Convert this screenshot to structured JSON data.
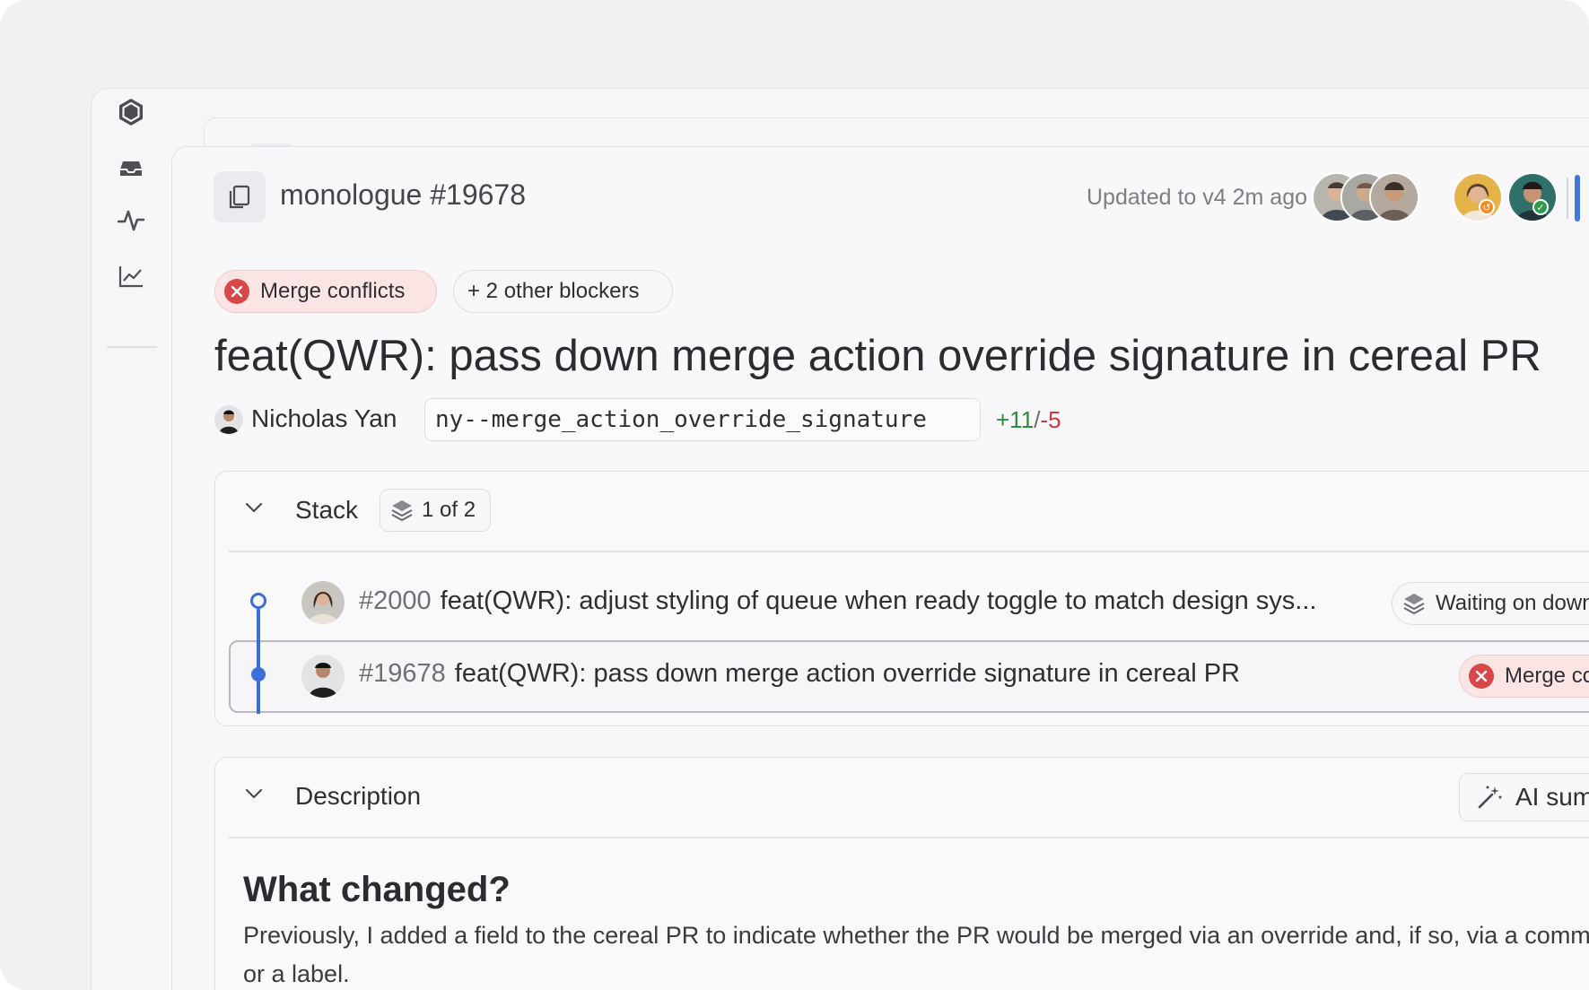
{
  "header": {
    "repo_title": "monologue #19678",
    "updated_text": "Updated to v4 2m ago",
    "reviewers": [
      "reviewer-1",
      "reviewer-2",
      "reviewer-3",
      "reviewer-4",
      "reviewer-5"
    ]
  },
  "blockers": {
    "merge_conflicts_label": "Merge conflicts",
    "other_blockers_label": "+ 2 other blockers"
  },
  "pr": {
    "title": "feat(QWR): pass down merge action override signature in cereal PR",
    "author": "Nicholas Yan",
    "branch": "ny--merge_action_override_signature",
    "additions": "+11",
    "separator": "/",
    "deletions": "-5"
  },
  "stack": {
    "title": "Stack",
    "count_label": "1 of 2",
    "items": [
      {
        "number": "#2000",
        "title": "feat(QWR): adjust styling of queue when ready toggle to match design sys...",
        "status": "Waiting on downstack"
      },
      {
        "number": "#19678",
        "title": "feat(QWR): pass down merge action override signature in cereal PR",
        "status": "Merge conflicts"
      }
    ]
  },
  "description": {
    "title": "Description",
    "ai_button_label": "AI summary",
    "heading": "What changed?",
    "body": "Previously, I added a field to the cereal PR to indicate whether the PR would be merged via an override and, if so, via a comment or a label."
  },
  "colors": {
    "accent": "#3b6fd6",
    "conflict_bg": "#fbe4e4",
    "conflict_icon": "#d84848",
    "additions": "#2f8a3a",
    "deletions": "#c83c3c"
  }
}
